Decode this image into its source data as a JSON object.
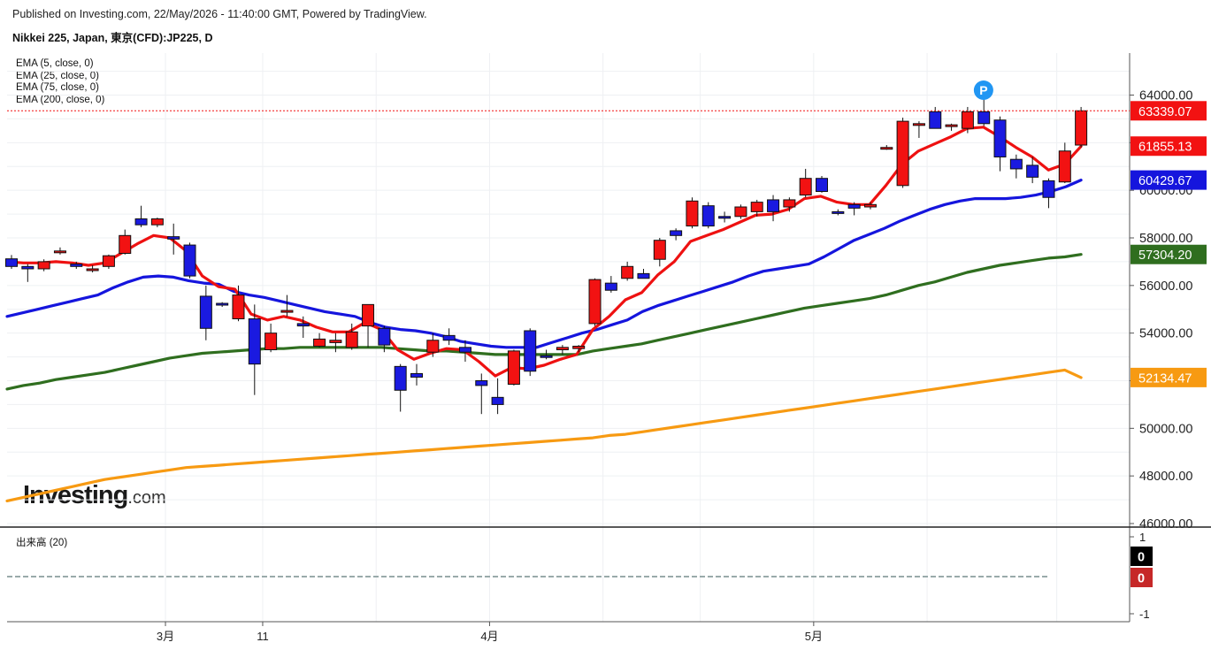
{
  "header": {
    "published": "Published on Investing.com, 22/May/2026 - 11:40:00 GMT, Powered by TradingView.",
    "instrument": "Nikkei 225, Japan, 東京(CFD):JP225, D"
  },
  "legend": {
    "ema": [
      {
        "label": "EMA (5, close, 0)",
        "color": "#ee1111"
      },
      {
        "label": "EMA (25, close, 0)",
        "color": "#1515dd"
      },
      {
        "label": "EMA (75, close, 0)",
        "color": "#2f6e1f"
      },
      {
        "label": "EMA (200, close, 0)",
        "color": "#f79a12"
      }
    ]
  },
  "volume": {
    "label": "出来高 (20)",
    "ticks": [
      "1",
      "-1"
    ],
    "value_badges": [
      {
        "text": "0",
        "color": "#000000"
      },
      {
        "text": "0",
        "color": "#c62828"
      }
    ]
  },
  "logo": {
    "word": "Investing",
    "suffix": ".com"
  },
  "marker": {
    "text": "P",
    "color": "#2196f3"
  },
  "chart_data": {
    "type": "candlestick",
    "ylim": [
      46000,
      65500
    ],
    "yticks": [
      64000,
      62000,
      60000,
      58000,
      56000,
      54000,
      52000,
      50000,
      48000,
      46000
    ],
    "ytick_labels": [
      "64000.00",
      "62000.00",
      "60000.00",
      "58000.00",
      "56000.00",
      "54000.00",
      "52000.00",
      "50000.00",
      "48000.00",
      "46000.00"
    ],
    "xlabels": [
      {
        "label": "3月",
        "i": 10
      },
      {
        "label": "11",
        "i": 16
      },
      {
        "label": "4月",
        "i": 30
      },
      {
        "label": "5月",
        "i": 50
      }
    ],
    "separators": [
      10,
      16,
      23,
      30,
      37,
      43,
      50,
      57,
      65
    ],
    "up_color": "#f21212",
    "down_color": "#1a1ae0",
    "candles": [
      [
        57120,
        57280,
        56700,
        56800
      ],
      [
        56800,
        56900,
        56150,
        56700
      ],
      [
        56700,
        57100,
        56600,
        57000
      ],
      [
        57400,
        57600,
        57300,
        57450
      ],
      [
        56900,
        57000,
        56700,
        56800
      ],
      [
        56700,
        56850,
        56550,
        56700
      ],
      [
        56800,
        57300,
        56700,
        57250
      ],
      [
        57350,
        58350,
        57300,
        58100
      ],
      [
        58800,
        59350,
        58450,
        58550
      ],
      [
        58550,
        58850,
        58450,
        58800
      ],
      [
        58050,
        58600,
        57300,
        57950
      ],
      [
        57700,
        57800,
        56300,
        56400
      ],
      [
        55550,
        56000,
        53700,
        54200
      ],
      [
        55250,
        55300,
        55100,
        55200
      ],
      [
        54600,
        56000,
        54500,
        55600
      ],
      [
        54600,
        55200,
        51400,
        52700
      ],
      [
        53300,
        54400,
        53200,
        54000
      ],
      [
        54900,
        55600,
        54700,
        54950
      ],
      [
        54400,
        54700,
        53800,
        54300
      ],
      [
        53450,
        54000,
        53400,
        53750
      ],
      [
        53600,
        54000,
        53200,
        53700
      ],
      [
        53400,
        54400,
        53300,
        54050
      ],
      [
        54300,
        54700,
        53400,
        55200
      ],
      [
        54200,
        54300,
        53200,
        53500
      ],
      [
        52600,
        52700,
        50700,
        51600
      ],
      [
        52300,
        52700,
        51800,
        52150
      ],
      [
        53200,
        54000,
        53000,
        53700
      ],
      [
        53900,
        54200,
        53500,
        53700
      ],
      [
        53400,
        53700,
        52800,
        53200
      ],
      [
        52000,
        52300,
        50600,
        51800
      ],
      [
        51300,
        52100,
        50600,
        51000
      ],
      [
        51850,
        53300,
        51800,
        53250
      ],
      [
        54100,
        54200,
        52200,
        52400
      ],
      [
        53050,
        53300,
        52900,
        53000
      ],
      [
        53300,
        53500,
        53100,
        53400
      ],
      [
        53350,
        53500,
        53200,
        53450
      ],
      [
        54400,
        56300,
        54300,
        56250
      ],
      [
        56100,
        56400,
        55700,
        55800
      ],
      [
        56300,
        57000,
        56200,
        56800
      ],
      [
        56500,
        56700,
        56300,
        56300
      ],
      [
        57100,
        58000,
        56800,
        57900
      ],
      [
        58300,
        58400,
        57900,
        58100
      ],
      [
        58500,
        59700,
        58400,
        59550
      ],
      [
        59350,
        59500,
        58400,
        58500
      ],
      [
        58900,
        59100,
        58650,
        58850
      ],
      [
        58900,
        59400,
        58800,
        59300
      ],
      [
        59100,
        59600,
        58900,
        59500
      ],
      [
        59600,
        59800,
        58700,
        59100
      ],
      [
        59300,
        59700,
        59100,
        59600
      ],
      [
        59800,
        60900,
        59700,
        60500
      ],
      [
        60500,
        60600,
        59900,
        59950
      ],
      [
        59100,
        59200,
        58950,
        59050
      ],
      [
        59400,
        59500,
        58950,
        59250
      ],
      [
        59300,
        59500,
        59200,
        59400
      ],
      [
        61800,
        61900,
        61700,
        61800
      ],
      [
        60200,
        63050,
        60100,
        62900
      ],
      [
        62750,
        62900,
        62200,
        62800
      ],
      [
        63300,
        63500,
        62600,
        62600
      ],
      [
        62700,
        62800,
        62500,
        62750
      ],
      [
        62600,
        63500,
        62400,
        63300
      ],
      [
        63300,
        63850,
        62700,
        62800
      ],
      [
        62950,
        63100,
        60800,
        61400
      ],
      [
        61300,
        61500,
        60500,
        60900
      ],
      [
        61050,
        61400,
        60300,
        60550
      ],
      [
        60400,
        60500,
        59250,
        59700
      ],
      [
        60350,
        62000,
        60300,
        61650
      ],
      [
        61900,
        63500,
        61800,
        63339.07
      ]
    ],
    "series": [
      {
        "name": "EMA (5, close, 0)",
        "color": "#ee1111",
        "values": [
          57000,
          56950,
          56950,
          57000,
          56950,
          56850,
          56950,
          57350,
          57750,
          58100,
          58000,
          57450,
          56400,
          55950,
          55850,
          54800,
          54550,
          54700,
          54550,
          54250,
          54050,
          54050,
          54450,
          54150,
          53300,
          52900,
          53150,
          53350,
          53300,
          52800,
          52200,
          52550,
          52500,
          52650,
          52900,
          53100,
          54150,
          54700,
          55400,
          55700,
          56450,
          57000,
          57850,
          58100,
          58350,
          58650,
          58950,
          59000,
          59200,
          59650,
          59750,
          59500,
          59400,
          59400,
          60200,
          61100,
          61650,
          61950,
          62250,
          62600,
          62650,
          62250,
          61800,
          61400,
          60850,
          61100,
          61850
        ]
      },
      {
        "name": "EMA (25, close, 0)",
        "color": "#1515dd",
        "values": [
          54700,
          54850,
          55000,
          55150,
          55300,
          55450,
          55600,
          55900,
          56150,
          56350,
          56400,
          56350,
          56200,
          56100,
          56050,
          55750,
          55600,
          55500,
          55350,
          55200,
          55050,
          54900,
          54800,
          54700,
          54450,
          54250,
          54150,
          54100,
          54000,
          53850,
          53650,
          53550,
          53450,
          53400,
          53400,
          53400,
          53600,
          53800,
          54000,
          54150,
          54350,
          54550,
          54900,
          55150,
          55350,
          55550,
          55750,
          55950,
          56150,
          56400,
          56600,
          56700,
          56800,
          56900,
          57200,
          57550,
          57900,
          58150,
          58400,
          58700,
          58950,
          59200,
          59400,
          59550,
          59650,
          59650,
          59650,
          59700,
          59800,
          59950,
          60150,
          60429.67
        ]
      },
      {
        "name": "EMA (75, close, 0)",
        "color": "#2f6e1f",
        "values": [
          51650,
          51800,
          51900,
          52050,
          52150,
          52250,
          52350,
          52500,
          52650,
          52800,
          52950,
          53050,
          53150,
          53200,
          53250,
          53300,
          53350,
          53350,
          53400,
          53400,
          53400,
          53400,
          53400,
          53400,
          53350,
          53300,
          53250,
          53250,
          53200,
          53150,
          53100,
          53100,
          53100,
          53100,
          53100,
          53100,
          53250,
          53350,
          53450,
          53550,
          53700,
          53850,
          54000,
          54150,
          54300,
          54450,
          54600,
          54750,
          54900,
          55050,
          55150,
          55250,
          55350,
          55450,
          55600,
          55800,
          56000,
          56150,
          56350,
          56550,
          56700,
          56850,
          56950,
          57050,
          57150,
          57200,
          57304.2
        ]
      },
      {
        "name": "EMA (200, close, 0)",
        "color": "#f79a12",
        "values": [
          46950,
          47100,
          47250,
          47400,
          47550,
          47700,
          47850,
          47950,
          48050,
          48150,
          48250,
          48350,
          48400,
          48450,
          48500,
          48550,
          48600,
          48650,
          48700,
          48750,
          48800,
          48850,
          48900,
          48950,
          49000,
          49050,
          49100,
          49150,
          49200,
          49250,
          49300,
          49350,
          49400,
          49450,
          49500,
          49550,
          49600,
          49700,
          49750,
          49850,
          49950,
          50050,
          50150,
          50250,
          50350,
          50450,
          50550,
          50650,
          50750,
          50850,
          50950,
          51050,
          51150,
          51250,
          51350,
          51450,
          51550,
          51650,
          51750,
          51850,
          51950,
          52050,
          52150,
          52250,
          52350,
          52450,
          52134.47
        ]
      }
    ],
    "price_badges": [
      {
        "value": "63339.07",
        "y": 63339.07,
        "color": "#f21212"
      },
      {
        "value": "61855.13",
        "y": 61855.13,
        "color": "#f21212"
      },
      {
        "value": "60429.67",
        "y": 60429.67,
        "color": "#1515dd"
      },
      {
        "value": "57304.20",
        "y": 57304.2,
        "color": "#2f6e1f"
      },
      {
        "value": "52134.47",
        "y": 52134.47,
        "color": "#f79a12"
      }
    ],
    "last_price_line": 63339.07
  }
}
